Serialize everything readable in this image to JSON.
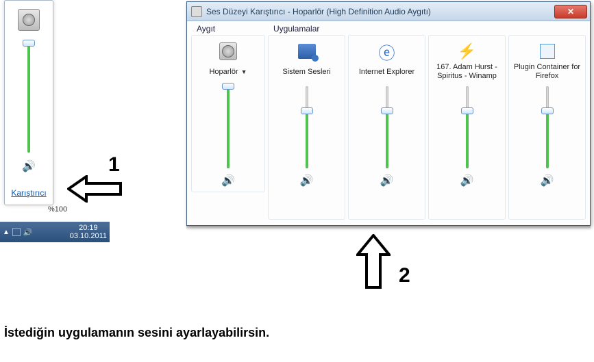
{
  "flyout": {
    "mixer_link": "Karıştırıcı",
    "slider": {
      "value_pct": 100
    },
    "percent_label": "%100"
  },
  "taskbar": {
    "time": "20:19",
    "date": "03.10.2011"
  },
  "annotations": {
    "one": "1",
    "two": "2",
    "caption": "İstediğin uygulamanın sesini ayarlayabilirsin."
  },
  "mixer": {
    "title": "Ses Düzeyi Karıştırıcı - Hoparlör (High Definition Audio Aygıtı)",
    "section_device": "Aygıt",
    "section_apps": "Uygulamalar",
    "columns": [
      {
        "label": "Hoparlör",
        "has_dropdown": true,
        "icon": "speaker-device-icon",
        "level_pct": 100
      },
      {
        "label": "Sistem Sesleri",
        "has_dropdown": false,
        "icon": "system-sounds-icon",
        "level_pct": 70
      },
      {
        "label": "Internet Explorer",
        "has_dropdown": false,
        "icon": "ie-icon",
        "level_pct": 70
      },
      {
        "label": "167. Adam Hurst - Spiritus - Winamp",
        "has_dropdown": false,
        "icon": "winamp-icon",
        "level_pct": 70
      },
      {
        "label": "Plugin Container for Firefox",
        "has_dropdown": false,
        "icon": "firefox-plugin-icon",
        "level_pct": 70
      }
    ]
  }
}
